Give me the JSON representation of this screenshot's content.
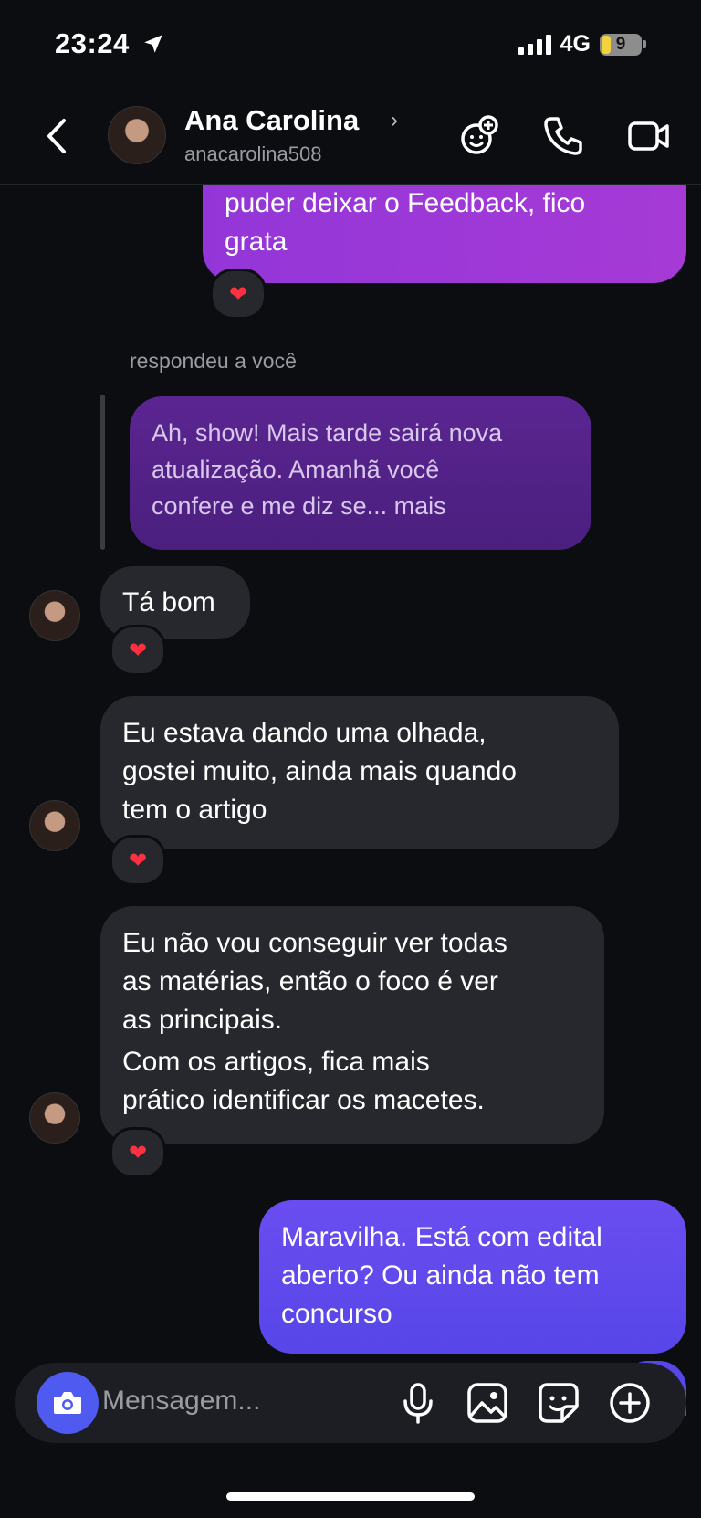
{
  "status_bar": {
    "time": "23:24",
    "network": "4G",
    "battery": "9"
  },
  "header": {
    "name": "Ana Carolina",
    "username": "anacarolina508"
  },
  "conversation": {
    "top_outgoing": {
      "lines": [
        "puder deixar o Feedback, fico",
        "grata"
      ],
      "reaction": "❤"
    },
    "reply_label": "respondeu a você",
    "quoted": {
      "lines": [
        "Ah, show! Mais tarde sairá nova",
        "atualização. Amanhã você",
        "confere e me diz se... mais"
      ]
    },
    "messages": [
      {
        "lines": [
          "Tá bom"
        ],
        "reaction": "❤"
      },
      {
        "lines": [
          "Eu estava dando uma olhada,",
          "gostei muito, ainda mais quando",
          "tem o artigo"
        ],
        "reaction": "❤"
      },
      {
        "lines": [
          "Eu não vou conseguir ver todas",
          "as matérias, então o foco é ver",
          "as principais.",
          "Com os artigos, fica mais",
          "prático identificar os macetes."
        ],
        "reaction": "❤"
      }
    ],
    "last_outgoing": {
      "lines": [
        "Maravilha. Está com edital",
        "aberto? Ou ainda não tem",
        "concurso"
      ]
    }
  },
  "composer": {
    "placeholder": "Mensagem..."
  }
}
